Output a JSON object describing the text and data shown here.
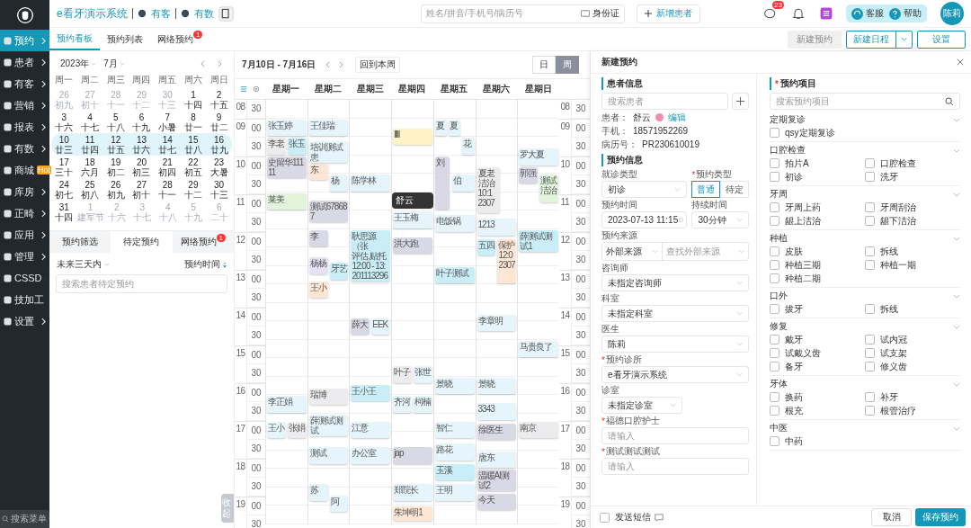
{
  "nav": {
    "items": [
      {
        "label": "预约",
        "selected": true
      },
      {
        "label": "患者",
        "selected": false
      },
      {
        "label": "有客",
        "selected": false
      },
      {
        "label": "营销",
        "selected": false
      },
      {
        "label": "报表",
        "selected": false
      },
      {
        "label": "有数",
        "selected": false
      },
      {
        "label": "商城",
        "selected": false,
        "badge": "Hot"
      },
      {
        "label": "库房",
        "selected": false
      },
      {
        "label": "正畸",
        "selected": false
      },
      {
        "label": "应用",
        "selected": false
      },
      {
        "label": "管理",
        "selected": false
      },
      {
        "label": "CSSD",
        "selected": false
      },
      {
        "label": "技加工",
        "selected": false
      },
      {
        "label": "设置",
        "selected": false
      }
    ],
    "search_placeholder": "搜索菜单"
  },
  "topbar": {
    "brand": "e看牙演示系统",
    "links": [
      "有客",
      "有数"
    ],
    "search_placeholder": "姓名/拼音/手机号/病历号",
    "id_button": "身份证",
    "add_patient": "新增患者",
    "message_badge": "23",
    "service": "客服",
    "help": "帮助",
    "avatar": "陈莉"
  },
  "tabs": [
    {
      "label": "预约看板",
      "selected": true
    },
    {
      "label": "预约列表",
      "selected": false
    },
    {
      "label": "网络预约",
      "selected": false,
      "badge": "1"
    }
  ],
  "actions": [
    {
      "label": "新建预约",
      "disabled": true,
      "kind": "plain"
    },
    {
      "label": "新建日程",
      "disabled": false,
      "kind": "split"
    },
    {
      "label": "设置",
      "disabled": false,
      "kind": "plain"
    }
  ],
  "mini_calendar": {
    "year": "2023年",
    "month": "7月",
    "weekdays": [
      "周一",
      "周二",
      "周三",
      "周四",
      "周五",
      "周六",
      "周日"
    ],
    "weeks": [
      {
        "selected": false,
        "days": [
          {
            "day": "26",
            "lunar": "初九",
            "muted": true
          },
          {
            "day": "27",
            "lunar": "初十",
            "muted": true
          },
          {
            "day": "28",
            "lunar": "十一",
            "muted": true
          },
          {
            "day": "29",
            "lunar": "十二",
            "muted": true
          },
          {
            "day": "30",
            "lunar": "十三",
            "muted": true
          },
          {
            "day": "1",
            "lunar": "十四",
            "muted": false
          },
          {
            "day": "2",
            "lunar": "十五",
            "muted": false
          }
        ]
      },
      {
        "selected": false,
        "days": [
          {
            "day": "3",
            "lunar": "十六",
            "muted": false
          },
          {
            "day": "4",
            "lunar": "十七",
            "muted": false
          },
          {
            "day": "5",
            "lunar": "十八",
            "muted": false
          },
          {
            "day": "6",
            "lunar": "十九",
            "muted": false
          },
          {
            "day": "7",
            "lunar": "小暑",
            "muted": false
          },
          {
            "day": "8",
            "lunar": "廿一",
            "muted": false
          },
          {
            "day": "9",
            "lunar": "廿二",
            "muted": false
          }
        ]
      },
      {
        "selected": true,
        "days": [
          {
            "day": "10",
            "lunar": "廿三",
            "muted": false
          },
          {
            "day": "11",
            "lunar": "廿四",
            "muted": false
          },
          {
            "day": "12",
            "lunar": "廿五",
            "muted": false
          },
          {
            "day": "13",
            "lunar": "廿六",
            "muted": false
          },
          {
            "day": "14",
            "lunar": "廿七",
            "muted": false
          },
          {
            "day": "15",
            "lunar": "廿八",
            "muted": false
          },
          {
            "day": "16",
            "lunar": "廿九",
            "muted": false
          }
        ]
      },
      {
        "selected": false,
        "days": [
          {
            "day": "17",
            "lunar": "三十",
            "muted": false
          },
          {
            "day": "18",
            "lunar": "六月",
            "muted": false
          },
          {
            "day": "19",
            "lunar": "初二",
            "muted": false
          },
          {
            "day": "20",
            "lunar": "初三",
            "muted": false
          },
          {
            "day": "21",
            "lunar": "初四",
            "muted": false
          },
          {
            "day": "22",
            "lunar": "初五",
            "muted": false
          },
          {
            "day": "23",
            "lunar": "大暑",
            "muted": false
          }
        ]
      },
      {
        "selected": false,
        "days": [
          {
            "day": "24",
            "lunar": "初七",
            "muted": false
          },
          {
            "day": "25",
            "lunar": "初八",
            "muted": false
          },
          {
            "day": "26",
            "lunar": "初九",
            "muted": false
          },
          {
            "day": "27",
            "lunar": "初十",
            "muted": false
          },
          {
            "day": "28",
            "lunar": "十一",
            "muted": false
          },
          {
            "day": "29",
            "lunar": "十二",
            "muted": false
          },
          {
            "day": "30",
            "lunar": "十三",
            "muted": false
          }
        ]
      },
      {
        "selected": false,
        "days": [
          {
            "day": "31",
            "lunar": "十四",
            "muted": false
          },
          {
            "day": "1",
            "lunar": "建军节",
            "muted": true
          },
          {
            "day": "2",
            "lunar": "十六",
            "muted": true
          },
          {
            "day": "3",
            "lunar": "十七",
            "muted": true
          },
          {
            "day": "4",
            "lunar": "十八",
            "muted": true
          },
          {
            "day": "5",
            "lunar": "十九",
            "muted": true
          },
          {
            "day": "6",
            "lunar": "二十",
            "muted": true
          }
        ]
      }
    ]
  },
  "pending": {
    "tabs": [
      {
        "label": "预约筛选",
        "selected": false
      },
      {
        "label": "待定预约",
        "selected": true
      },
      {
        "label": "网络预约",
        "selected": false,
        "badge": "1"
      }
    ],
    "range": "未来三天内",
    "sort": "预约时间",
    "search_placeholder": "搜索患者待定预约",
    "collapse": "收起"
  },
  "schedule": {
    "range": "7月10日 - 7月16日",
    "today_button": "回到本周",
    "views": [
      {
        "label": "日",
        "selected": false
      },
      {
        "label": "周",
        "selected": true
      }
    ],
    "time_axis_left": [
      {
        "hour": "08",
        "marks": [
          "30"
        ]
      },
      {
        "hour": "09",
        "marks": [
          "00",
          "30"
        ]
      },
      {
        "hour": "10",
        "marks": [
          "00",
          "30"
        ]
      },
      {
        "hour": "11",
        "marks": [
          "00",
          "30"
        ]
      },
      {
        "hour": "12",
        "marks": [
          "00",
          "30"
        ]
      },
      {
        "hour": "13",
        "marks": [
          "00",
          "30"
        ]
      },
      {
        "hour": "14",
        "marks": [
          "00",
          "30"
        ]
      },
      {
        "hour": "15",
        "marks": [
          "00",
          "30"
        ]
      },
      {
        "hour": "16",
        "marks": [
          "00",
          "30"
        ]
      },
      {
        "hour": "17",
        "marks": [
          "00",
          "30"
        ]
      },
      {
        "hour": "18",
        "marks": [
          "00",
          "30"
        ]
      },
      {
        "hour": "19",
        "marks": [
          "00",
          "30"
        ]
      }
    ],
    "time_axis_right": [
      {
        "hour": "08",
        "marks": [
          "30"
        ]
      },
      {
        "hour": "09",
        "marks": [
          "00",
          "30"
        ]
      },
      {
        "hour": "10",
        "marks": [
          "00",
          "30"
        ]
      },
      {
        "hour": "11",
        "marks": [
          "00",
          "30"
        ]
      },
      {
        "hour": "12",
        "marks": [
          "00",
          "30"
        ]
      },
      {
        "hour": "13",
        "marks": [
          "00",
          "30"
        ]
      },
      {
        "hour": "14",
        "marks": [
          "00",
          "30"
        ]
      },
      {
        "hour": "15",
        "marks": [
          "00",
          "30"
        ]
      },
      {
        "hour": "16",
        "marks": [
          "00",
          "30"
        ]
      },
      {
        "hour": "17",
        "marks": [
          "00",
          "30"
        ]
      },
      {
        "hour": "18",
        "marks": [
          "00",
          "30"
        ]
      },
      {
        "hour": "19",
        "marks": [
          "00",
          "30"
        ]
      }
    ],
    "days": [
      {
        "name": "星期一",
        "events": [
          {
            "lines": [
              "张玉婷"
            ],
            "color": "#e6f5fc"
          },
          {
            "lines": [
              "李老"
            ],
            "color": "#ececee"
          },
          {
            "lines": [
              "张玉"
            ],
            "color": "#c9eef8"
          },
          {
            "lines": [
              "史留华11111"
            ],
            "color": "#d9d9e6"
          },
          {
            "lines": [
              "莱美"
            ],
            "color": "#e2f5dc"
          },
          {
            "lines": [
              "李正娟"
            ],
            "color": "#e6f5fc"
          },
          {
            "lines": [
              "王小"
            ],
            "color": "#e6f5fc"
          },
          {
            "lines": [
              "张娟"
            ],
            "color": "#ececee"
          }
        ]
      },
      {
        "name": "星期二",
        "events": [
          {
            "lines": [
              "王佳瑞"
            ],
            "color": "#e6f5fc"
          },
          {
            "lines": [
              "培训测试患"
            ],
            "color": "#e6f5fc"
          },
          {
            "lines": [
              "东"
            ],
            "color": "#fde7d4"
          },
          {
            "lines": [
              "杨"
            ],
            "color": "#e6f5fc"
          },
          {
            "lines": [
              "测试678687"
            ],
            "color": "#d9d9e6"
          },
          {
            "lines": [
              "李"
            ],
            "color": "#d9d9e6"
          },
          {
            "lines": [
              "杨杨"
            ],
            "color": "#e4e2f6"
          },
          {
            "lines": [
              "牙艺"
            ],
            "color": "#c9eef8"
          },
          {
            "lines": [
              "王小"
            ],
            "color": "#fde7d4"
          },
          {
            "lines": [
              "瑞博"
            ],
            "color": "#ececee"
          },
          {
            "lines": [
              "薛测试测试"
            ],
            "color": "#e6f5fc"
          },
          {
            "lines": [
              "测试"
            ],
            "color": "#e6f5fc"
          },
          {
            "lines": [
              "苏"
            ],
            "color": "#e6f5fc"
          },
          {
            "lines": [
              "阿"
            ],
            "color": "#e6f5fc"
          }
        ]
      },
      {
        "name": "星期三",
        "events": [
          {
            "lines": [
              "陈学林"
            ],
            "color": "#e6f5fc"
          },
          {
            "lines": [
              "耿思源（张",
              "评估,贴托",
              "12:00 - 13:",
              "201113296"
            ],
            "color": "#c9eef8"
          },
          {
            "lines": [
              "薛大"
            ],
            "color": "#d9d9e6"
          },
          {
            "lines": [
              "EEK"
            ],
            "color": "#e6f5fc"
          },
          {
            "lines": [
              "王小王"
            ],
            "color": "#c9eef8"
          },
          {
            "lines": [
              "江意"
            ],
            "color": "#e6f5fc"
          },
          {
            "lines": [
              "办公室"
            ],
            "color": "#e6f5fc"
          }
        ]
      },
      {
        "name": "星期四",
        "events": [
          {
            "lines": [
              "lllll"
            ],
            "color": "#fdf3c4"
          },
          {
            "lines": [
              "王玉梅"
            ],
            "color": "#e6f5fc"
          },
          {
            "lines": [
              "洪大跑"
            ],
            "color": "#d9d9e6"
          },
          {
            "lines": [
              "叶子"
            ],
            "color": "#ececee"
          },
          {
            "lines": [
              "张世"
            ],
            "color": "#e6f5fc"
          },
          {
            "lines": [
              "齐河"
            ],
            "color": "#e6f5fc"
          },
          {
            "lines": [
              "柯楠"
            ],
            "color": "#e6f5fc"
          },
          {
            "lines": [
              "jap"
            ],
            "color": "#d9d9e6"
          },
          {
            "lines": [
              "郑院长"
            ],
            "color": "#e6f5fc"
          },
          {
            "lines": [
              "朱坤明1"
            ],
            "color": "#fde7d4"
          }
        ]
      },
      {
        "name": "星期五",
        "events": [
          {
            "lines": [
              "夏"
            ],
            "color": "#e6f5fc"
          },
          {
            "lines": [
              "夏"
            ],
            "color": "#e6f5fc"
          },
          {
            "lines": [
              "花"
            ],
            "color": "#e6f5fc"
          },
          {
            "lines": [
              "刘"
            ],
            "color": "#d9d9e6"
          },
          {
            "lines": [
              "伯"
            ],
            "color": "#e6f5fc"
          },
          {
            "lines": [
              "电饭锅"
            ],
            "color": "#e6f5fc"
          },
          {
            "lines": [
              "叶子测试"
            ],
            "color": "#c9eef8"
          },
          {
            "lines": [
              "景晓"
            ],
            "color": "#e6f5fc"
          },
          {
            "lines": [
              "智仁"
            ],
            "color": "#e6f5fc"
          },
          {
            "lines": [
              "路花"
            ],
            "color": "#e6f5fc"
          },
          {
            "lines": [
              "玉溪"
            ],
            "color": "#c9eef8"
          },
          {
            "lines": [
              "王明"
            ],
            "color": "#e6f5fc"
          }
        ]
      },
      {
        "name": "星期六",
        "events": [
          {
            "lines": [
              "夏老",
              "洁治",
              "10:1",
              "2307"
            ],
            "color": "#ececee"
          },
          {
            "lines": [
              "1213"
            ],
            "color": "#e6f5fc"
          },
          {
            "lines": [
              "五四"
            ],
            "color": "#c9eef8"
          },
          {
            "lines": [
              "保护",
              "12:0",
              "2307"
            ],
            "color": "#fde7d4"
          },
          {
            "lines": [
              "李章明"
            ],
            "color": "#e6f5fc"
          },
          {
            "lines": [
              "景晓"
            ],
            "color": "#e6f5fc"
          },
          {
            "lines": [
              "3343"
            ],
            "color": "#e6f5fc"
          },
          {
            "lines": [
              "徐医生"
            ],
            "color": "#d9d9e6"
          },
          {
            "lines": [
              "唐东"
            ],
            "color": "#e6f5fc"
          },
          {
            "lines": [
              "温暖AI测试2"
            ],
            "color": "#d9d9e6"
          },
          {
            "lines": [
              "今天"
            ],
            "color": "#d9d9e6"
          }
        ]
      },
      {
        "name": "星期日",
        "events": [
          {
            "lines": [
              "罗大夏"
            ],
            "color": "#e6f5fc"
          },
          {
            "lines": [
              "郭强"
            ],
            "color": "#d9d9e6"
          },
          {
            "lines": [
              "测试",
              "洁治"
            ],
            "color": "#e2f5dc"
          },
          {
            "lines": [
              "薛测试测试1"
            ],
            "color": "#c9eef8"
          },
          {
            "lines": [
              "马贵良了"
            ],
            "color": "#e6f5fc"
          },
          {
            "lines": [
              "南京"
            ],
            "color": "#ececee"
          }
        ]
      }
    ],
    "tooltip": {
      "text": "舒云"
    }
  },
  "drawer": {
    "title": "新建预约",
    "patient_section": "患者信息",
    "patient_search": "搜索患者",
    "patient": {
      "label": "患者：",
      "name": "舒云",
      "edit": "编辑"
    },
    "info": [
      {
        "label": "手机：",
        "value": "18571952269"
      },
      {
        "label": "病历号：",
        "value": "PR230610019"
      }
    ],
    "booking_section": "预约信息",
    "rows": [
      [
        {
          "label": "就诊类型",
          "kind": "select",
          "value": "初诊"
        },
        {
          "label": "预约类型",
          "mark": "*",
          "kind": "segmented",
          "options": [
            {
              "label": "普通",
              "selected": true
            },
            {
              "label": "待定",
              "selected": false
            }
          ]
        }
      ],
      [
        {
          "label": "预约时间",
          "kind": "datetime",
          "value": "2023-07-13 11:15"
        },
        {
          "label": "持续时间",
          "kind": "select",
          "value": "30分钟"
        }
      ],
      [
        {
          "label": "预约来源",
          "kind": "combo",
          "value": "外部来源",
          "placeholder": "查找外部来源"
        }
      ],
      [
        {
          "label": "咨询师",
          "kind": "select",
          "value": "未指定咨询师"
        }
      ],
      [
        {
          "label": "科室",
          "kind": "select",
          "value": "未指定科室"
        }
      ],
      [
        {
          "label": "医生",
          "kind": "select",
          "value": "陈莉"
        }
      ],
      [
        {
          "label": "预约诊所",
          "mark": "*",
          "kind": "select",
          "value": "e看牙演示系统"
        }
      ],
      [
        {
          "label": "诊室",
          "kind": "short",
          "value": "未指定诊室"
        }
      ],
      [
        {
          "label": "福德口腔护士",
          "mark": "*",
          "kind": "input",
          "placeholder": "请输入"
        }
      ],
      [
        {
          "label": "测试测试测试",
          "mark": "*",
          "kind": "input",
          "placeholder": "请输入"
        }
      ]
    ],
    "items_section": "预约项目",
    "items_mark": "*",
    "items_search": "搜索预约项目",
    "groups": [
      {
        "name": "定期复诊",
        "items": [
          {
            "label": "qsy定期复诊",
            "checked": false
          }
        ]
      },
      {
        "name": "口腔检查",
        "items": [
          {
            "label": "拍片A",
            "checked": false
          },
          {
            "label": "口腔检查",
            "checked": false
          },
          {
            "label": "初诊",
            "checked": false
          },
          {
            "label": "洗牙",
            "checked": false
          }
        ]
      },
      {
        "name": "牙周",
        "items": [
          {
            "label": "牙周上药",
            "checked": false
          },
          {
            "label": "牙周刮治",
            "checked": false
          },
          {
            "label": "龈上洁治",
            "checked": false
          },
          {
            "label": "龈下洁治",
            "checked": false
          }
        ]
      },
      {
        "name": "种植",
        "items": [
          {
            "label": "皮肤",
            "checked": false
          },
          {
            "label": "拆线",
            "checked": false
          },
          {
            "label": "种植三期",
            "checked": false
          },
          {
            "label": "种植一期",
            "checked": false
          },
          {
            "label": "种植二期",
            "checked": false
          }
        ]
      },
      {
        "name": "口外",
        "items": [
          {
            "label": "拔牙",
            "checked": false
          },
          {
            "label": "拆线",
            "checked": false
          }
        ]
      },
      {
        "name": "修复",
        "items": [
          {
            "label": "戴牙",
            "checked": false
          },
          {
            "label": "试内冠",
            "checked": false
          },
          {
            "label": "试戴义齿",
            "checked": false
          },
          {
            "label": "试支架",
            "checked": false
          },
          {
            "label": "备牙",
            "checked": false
          },
          {
            "label": "修义齿",
            "checked": false
          }
        ]
      },
      {
        "name": "牙体",
        "items": [
          {
            "label": "换药",
            "checked": false
          },
          {
            "label": "补牙",
            "checked": false
          },
          {
            "label": "根充",
            "checked": false
          },
          {
            "label": "根管治疗",
            "checked": false
          }
        ]
      },
      {
        "name": "中医",
        "items": [
          {
            "label": "中药",
            "checked": false
          }
        ]
      }
    ],
    "sms": {
      "label": "发送短信",
      "checked": false
    },
    "cancel": "取消",
    "save": "保存预约"
  }
}
